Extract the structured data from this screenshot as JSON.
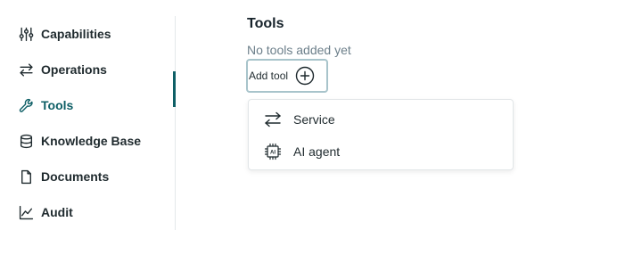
{
  "sidebar": {
    "items": [
      {
        "label": "Capabilities",
        "icon": "sliders-icon"
      },
      {
        "label": "Operations",
        "icon": "arrows-swap-icon"
      },
      {
        "label": "Tools",
        "icon": "wrench-icon",
        "active": true
      },
      {
        "label": "Knowledge Base",
        "icon": "database-icon"
      },
      {
        "label": "Documents",
        "icon": "document-icon"
      },
      {
        "label": "Audit",
        "icon": "line-chart-icon"
      }
    ]
  },
  "main": {
    "title": "Tools",
    "empty_text": "No tools added yet",
    "add_tool_label": "Add tool"
  },
  "dropdown": {
    "items": [
      {
        "label": "Service",
        "icon": "arrows-swap-icon"
      },
      {
        "label": "AI agent",
        "icon": "ai-chip-icon"
      }
    ]
  },
  "colors": {
    "accent": "#0e5f66",
    "text": "#1f2a2e",
    "muted": "#6c7f8a",
    "button_border": "#a8c4cb"
  }
}
